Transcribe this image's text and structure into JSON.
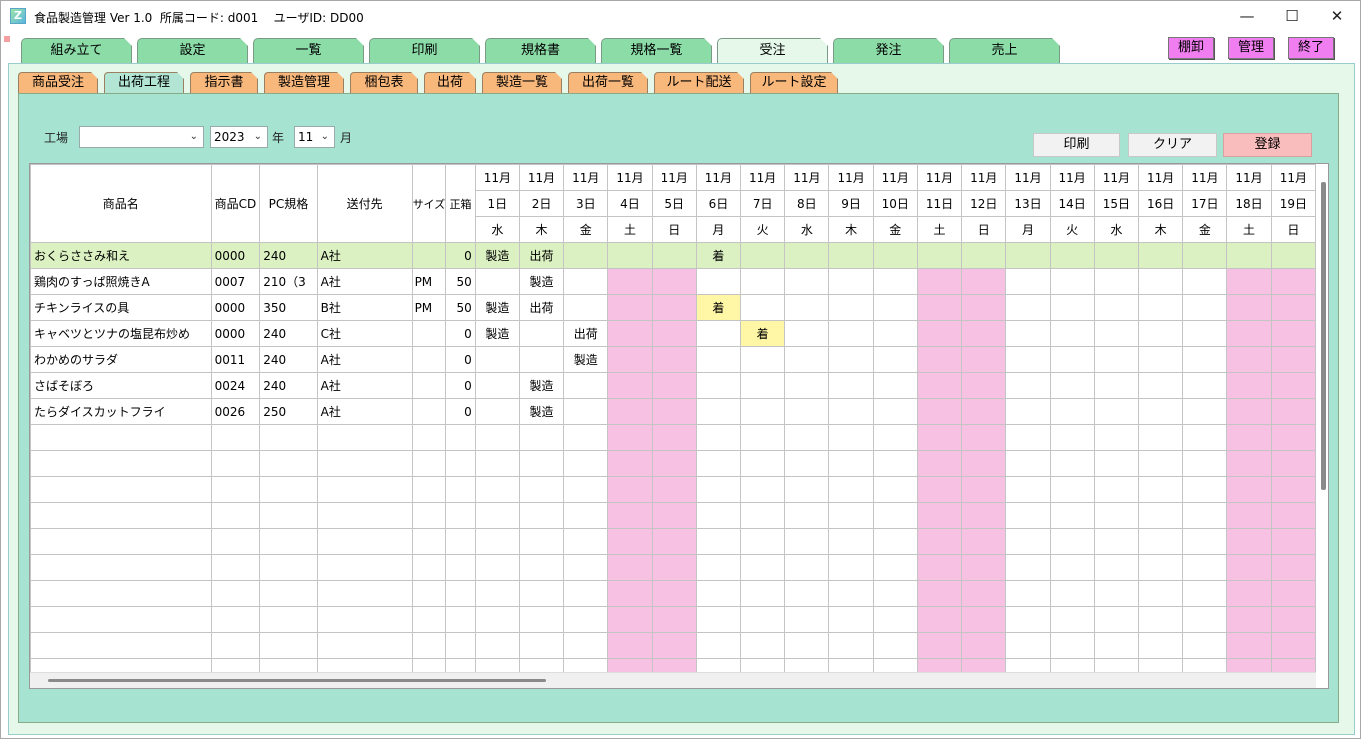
{
  "window": {
    "title": "食品製造管理 Ver 1.0  所属コード: d001    ユーザID: DD00",
    "app_icon_letter": "Z",
    "minimize_glyph": "—",
    "maximize_glyph": "☐",
    "close_glyph": "✕"
  },
  "top_tabs": [
    {
      "label": "組み立て",
      "active": false
    },
    {
      "label": "設定",
      "active": false
    },
    {
      "label": "一覧",
      "active": false
    },
    {
      "label": "印刷",
      "active": false
    },
    {
      "label": "規格書",
      "active": false
    },
    {
      "label": "規格一覧",
      "active": false
    },
    {
      "label": "受注",
      "active": true
    },
    {
      "label": "発注",
      "active": false
    },
    {
      "label": "売上",
      "active": false
    }
  ],
  "menu_buttons": {
    "tanaoroshi": "棚卸",
    "kanri": "管理",
    "shuryo": "終了"
  },
  "sub_tabs": [
    {
      "label": "商品受注",
      "active": false
    },
    {
      "label": "出荷工程",
      "active": true
    },
    {
      "label": "指示書",
      "active": false
    },
    {
      "label": "製造管理",
      "active": false
    },
    {
      "label": "梱包表",
      "active": false
    },
    {
      "label": "出荷",
      "active": false
    },
    {
      "label": "製造一覧",
      "active": false
    },
    {
      "label": "出荷一覧",
      "active": false
    },
    {
      "label": "ルート配送",
      "active": false
    },
    {
      "label": "ルート設定",
      "active": false
    }
  ],
  "filters": {
    "factory_label": "工場",
    "factory_value": "",
    "year_value": "2023",
    "year_label": "年",
    "month_value": "11",
    "month_label": "月"
  },
  "actions": {
    "print": "印刷",
    "clear": "クリア",
    "register": "登録"
  },
  "colors": {
    "accent_tab": "#8cdca8",
    "sub_tab": "#f8b77b",
    "panel": "#a6e3d0",
    "weekend": "#f7c1e4",
    "arrival": "#fff7a6",
    "selected_row": "#dbf1c1",
    "magenta_button": "#f07ef0",
    "register_button": "#f9bdbd"
  },
  "grid": {
    "headers": {
      "name": "商品名",
      "cd": "商品CD",
      "pc": "PC規格",
      "dest": "送付先",
      "size": "サイズ",
      "box": "正箱"
    },
    "days": [
      {
        "m": "11月",
        "d": "1日",
        "w": "水",
        "weekend": false
      },
      {
        "m": "11月",
        "d": "2日",
        "w": "木",
        "weekend": false
      },
      {
        "m": "11月",
        "d": "3日",
        "w": "金",
        "weekend": false
      },
      {
        "m": "11月",
        "d": "4日",
        "w": "土",
        "weekend": true
      },
      {
        "m": "11月",
        "d": "5日",
        "w": "日",
        "weekend": true
      },
      {
        "m": "11月",
        "d": "6日",
        "w": "月",
        "weekend": false
      },
      {
        "m": "11月",
        "d": "7日",
        "w": "火",
        "weekend": false
      },
      {
        "m": "11月",
        "d": "8日",
        "w": "水",
        "weekend": false
      },
      {
        "m": "11月",
        "d": "9日",
        "w": "木",
        "weekend": false
      },
      {
        "m": "11月",
        "d": "10日",
        "w": "金",
        "weekend": false
      },
      {
        "m": "11月",
        "d": "11日",
        "w": "土",
        "weekend": true
      },
      {
        "m": "11月",
        "d": "12日",
        "w": "日",
        "weekend": true
      },
      {
        "m": "11月",
        "d": "13日",
        "w": "月",
        "weekend": false
      },
      {
        "m": "11月",
        "d": "14日",
        "w": "火",
        "weekend": false
      },
      {
        "m": "11月",
        "d": "15日",
        "w": "水",
        "weekend": false
      },
      {
        "m": "11月",
        "d": "16日",
        "w": "木",
        "weekend": false
      },
      {
        "m": "11月",
        "d": "17日",
        "w": "金",
        "weekend": false
      },
      {
        "m": "11月",
        "d": "18日",
        "w": "土",
        "weekend": true
      },
      {
        "m": "11月",
        "d": "19日",
        "w": "日",
        "weekend": true
      }
    ],
    "rows": [
      {
        "name": "おくらささみ和え",
        "cd": "0000",
        "pc": "240",
        "dest": "A社",
        "size": "",
        "box": "0",
        "selected": true,
        "cells": [
          "製造",
          "出荷",
          "",
          "",
          "",
          "着",
          "",
          "",
          "",
          "",
          "",
          "",
          "",
          "",
          "",
          "",
          "",
          "",
          ""
        ],
        "hi": []
      },
      {
        "name": "鶏肉のすっぱ照焼きA",
        "cd": "0007",
        "pc": "210（3",
        "dest": "A社",
        "size": "PM",
        "box": "50",
        "selected": false,
        "cells": [
          "",
          "製造",
          "",
          "",
          "",
          "",
          "",
          "",
          "",
          "",
          "",
          "",
          "",
          "",
          "",
          "",
          "",
          "",
          ""
        ],
        "hi": []
      },
      {
        "name": "チキンライスの具",
        "cd": "0000",
        "pc": "350",
        "dest": "B社",
        "size": "PM",
        "box": "50",
        "selected": false,
        "cells": [
          "製造",
          "出荷",
          "",
          "",
          "",
          "着",
          "",
          "",
          "",
          "",
          "",
          "",
          "",
          "",
          "",
          "",
          "",
          "",
          ""
        ],
        "hi": [
          5
        ]
      },
      {
        "name": "キャベツとツナの塩昆布炒め",
        "cd": "0000",
        "pc": "240",
        "dest": "C社",
        "size": "",
        "box": "0",
        "selected": false,
        "cells": [
          "製造",
          "",
          "出荷",
          "",
          "",
          "",
          "着",
          "",
          "",
          "",
          "",
          "",
          "",
          "",
          "",
          "",
          "",
          "",
          ""
        ],
        "hi": [
          6
        ]
      },
      {
        "name": "わかめのサラダ",
        "cd": "0011",
        "pc": "240",
        "dest": "A社",
        "size": "",
        "box": "0",
        "selected": false,
        "cells": [
          "",
          "",
          "製造",
          "",
          "",
          "",
          "",
          "",
          "",
          "",
          "",
          "",
          "",
          "",
          "",
          "",
          "",
          "",
          ""
        ],
        "hi": []
      },
      {
        "name": "さばそぼろ",
        "cd": "0024",
        "pc": "240",
        "dest": "A社",
        "size": "",
        "box": "0",
        "selected": false,
        "cells": [
          "",
          "製造",
          "",
          "",
          "",
          "",
          "",
          "",
          "",
          "",
          "",
          "",
          "",
          "",
          "",
          "",
          "",
          "",
          ""
        ],
        "hi": []
      },
      {
        "name": "たらダイスカットフライ",
        "cd": "0026",
        "pc": "250",
        "dest": "A社",
        "size": "",
        "box": "0",
        "selected": false,
        "cells": [
          "",
          "製造",
          "",
          "",
          "",
          "",
          "",
          "",
          "",
          "",
          "",
          "",
          "",
          "",
          "",
          "",
          "",
          "",
          ""
        ],
        "hi": []
      }
    ],
    "empty_rows": 10
  }
}
